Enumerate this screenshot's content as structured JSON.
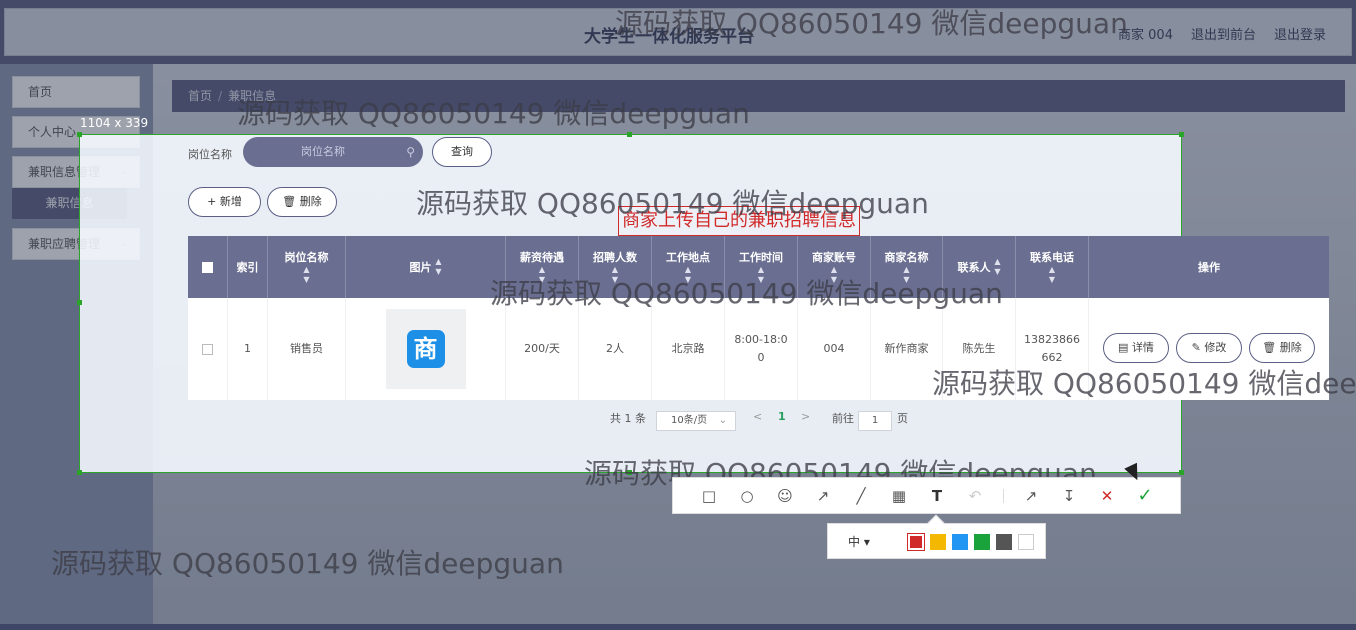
{
  "header": {
    "site_title": "大学生一体化服务平台",
    "links": [
      "商家 004",
      "退出到前台",
      "退出登录"
    ]
  },
  "sidebar": {
    "items": [
      {
        "label": "首页",
        "has_chevron": false
      },
      {
        "label": "个人中心",
        "has_chevron": false
      },
      {
        "label": "兼职信息管理",
        "has_chevron": true
      },
      {
        "label": "兼职应聘管理",
        "has_chevron": true
      }
    ],
    "active_sub": "兼职信息"
  },
  "breadcrumb": {
    "home": "首页",
    "separator": "/",
    "current": "兼职信息"
  },
  "capture": {
    "size_label": "1104 x 339"
  },
  "search": {
    "label": "岗位名称",
    "placeholder": "岗位名称",
    "query_button": "查询"
  },
  "actions": {
    "add": "新增",
    "delete": "删除"
  },
  "annotation_text": "商家上传自己的兼职招聘信息",
  "table": {
    "headers": [
      "索引",
      "岗位名称",
      "图片",
      "薪资待遇",
      "招聘人数",
      "工作地点",
      "工作时间",
      "商家账号",
      "商家名称",
      "联系人",
      "联系电话",
      "操作"
    ],
    "rows": [
      {
        "index": "1",
        "job_name": "销售员",
        "image_glyph": "商",
        "salary": "200/天",
        "headcount": "2人",
        "location": "北京路",
        "work_time": "8:00-18:00",
        "merchant_account": "004",
        "merchant_name": "新作商家",
        "contact": "陈先生",
        "phone": "13823866662"
      }
    ],
    "row_actions": [
      "详情",
      "修改",
      "删除"
    ]
  },
  "pagination": {
    "total_text": "共 1 条",
    "page_size": "10条/页",
    "current_page": "1",
    "goto_label": "前往",
    "goto_value": "1",
    "page_suffix": "页"
  },
  "watermark_text": "源码获取 QQ86050149 微信deepguan",
  "screenshot_tool": {
    "font_size_label": "中",
    "colors": [
      "#d12a2a",
      "#f5b800",
      "#2196f3",
      "#1aa33a",
      "#555555",
      "#ffffff"
    ]
  },
  "colors": {
    "primary": "#5b5f84",
    "table_header": "#6a6e90",
    "capture_border": "#2aa52a",
    "annotation": "#d12a2a"
  }
}
